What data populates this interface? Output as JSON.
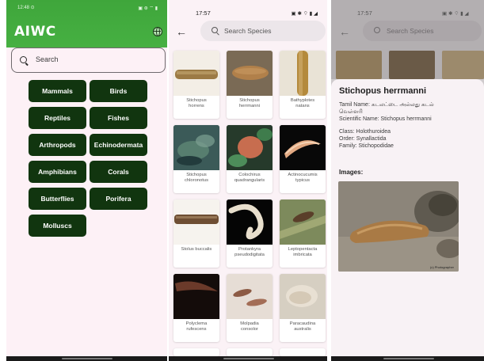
{
  "screen1": {
    "status_time": "12:48 ⊙",
    "status_icons": "▣ ⊛ ⌔ ▮",
    "app_title": "AIWC",
    "search_placeholder": "Search",
    "categories": [
      "Mammals",
      "Birds",
      "Reptiles",
      "Fishes",
      "Arthropods",
      "Echinodermata",
      "Amphibians",
      "Corals",
      "Butterflies",
      "Porifera",
      "Molluscs"
    ],
    "accent_color": "#43ad3f",
    "button_color": "#11350f"
  },
  "screen2": {
    "status_time": "17:57",
    "status_icons": "▣ ✱ ⌔ ▮ ◢",
    "search_placeholder": "Search Species",
    "species": [
      {
        "name": "Stichopus\nhorrens",
        "thumb_icon": "sea-cucumber-image"
      },
      {
        "name": "Stichopus\nherrmanni",
        "thumb_icon": "sea-cucumber-image"
      },
      {
        "name": "Bathyplotes\nnatans",
        "thumb_icon": "sea-cucumber-image"
      },
      {
        "name": "Stichopus\nchloronotus",
        "thumb_icon": "sea-cucumber-image"
      },
      {
        "name": "Colochirus\nquadrangularis",
        "thumb_icon": "sea-cucumber-image"
      },
      {
        "name": "Actinocucumis\ntypicus",
        "thumb_icon": "sea-cucumber-image"
      },
      {
        "name": "Stolus buccalis",
        "thumb_icon": "sea-cucumber-image"
      },
      {
        "name": "Protankyra\npseudodigitata",
        "thumb_icon": "sea-cucumber-image"
      },
      {
        "name": "Leptopentacta\nimbricata",
        "thumb_icon": "sea-cucumber-image"
      },
      {
        "name": "Polyclema\nrufescens",
        "thumb_icon": "sea-cucumber-image"
      },
      {
        "name": "Molpadia\nconsolor",
        "thumb_icon": "sea-cucumber-image"
      },
      {
        "name": "Paracaudina\naustralis",
        "thumb_icon": "sea-cucumber-image"
      }
    ]
  },
  "screen3": {
    "status_time": "17:57",
    "status_icons": "▣ ✱ ⌔ ▮ ◢",
    "search_placeholder": "Search Species",
    "detail": {
      "title": "Stichopus herrmanni",
      "tamil_line1": "Tamil Name: கடலட்டை அல்லது கடல்",
      "tamil_line2": "வெள்ளரி",
      "scientific": "Scientific Name: Stichopus herrmanni",
      "class": "Class: Holothuroidea",
      "order": "Order: Synallactida",
      "family": "Family: Stichopodidae",
      "images_label": "Images:",
      "photo_credit": "(c) Photographer"
    }
  }
}
